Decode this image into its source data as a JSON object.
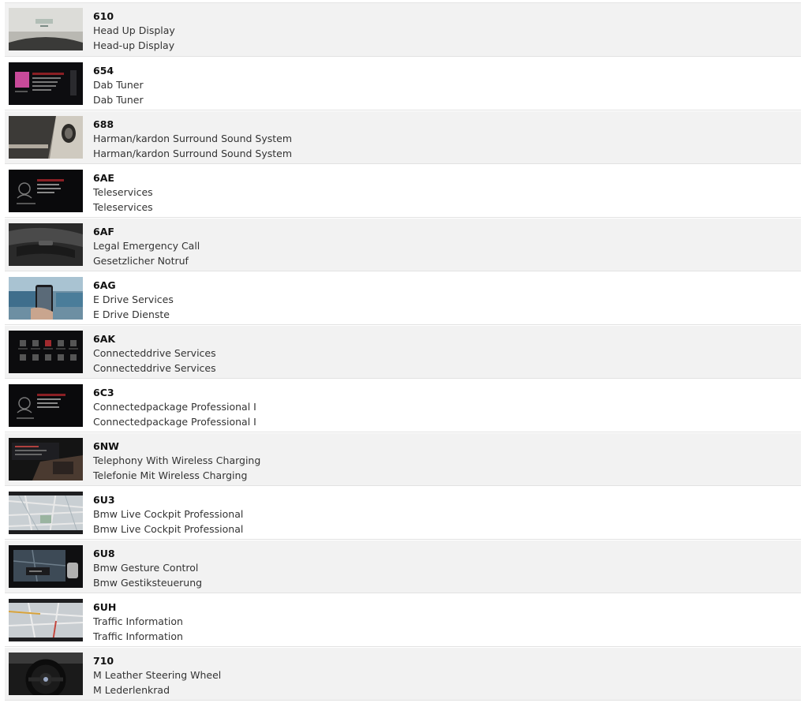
{
  "options": [
    {
      "code": "610",
      "name_en": "Head Up Display",
      "name_de": "Head-up Display",
      "thumb": "hud-image"
    },
    {
      "code": "654",
      "name_en": "Dab Tuner",
      "name_de": "Dab Tuner",
      "thumb": "radio-screen-image"
    },
    {
      "code": "688",
      "name_en": "Harman/kardon Surround Sound System",
      "name_de": "Harman/kardon Surround Sound System",
      "thumb": "door-speaker-image"
    },
    {
      "code": "6AE",
      "name_en": "Teleservices",
      "name_de": "Teleservices",
      "thumb": "teleservices-screen-image"
    },
    {
      "code": "6AF",
      "name_en": "Legal Emergency Call",
      "name_de": "Gesetzlicher Notruf",
      "thumb": "sos-button-image"
    },
    {
      "code": "6AG",
      "name_en": "E Drive Services",
      "name_de": "E Drive Dienste",
      "thumb": "phone-app-image"
    },
    {
      "code": "6AK",
      "name_en": "Connecteddrive Services",
      "name_de": "Connecteddrive Services",
      "thumb": "connecteddrive-menu-image"
    },
    {
      "code": "6C3",
      "name_en": "Connectedpackage Professional I",
      "name_de": "Connectedpackage Professional I",
      "thumb": "connected-package-screen-image"
    },
    {
      "code": "6NW",
      "name_en": "Telephony With Wireless Charging",
      "name_de": "Telefonie Mit Wireless Charging",
      "thumb": "wireless-charging-image"
    },
    {
      "code": "6U3",
      "name_en": "Bmw Live Cockpit Professional",
      "name_de": "Bmw Live Cockpit Professional",
      "thumb": "navigation-map-image"
    },
    {
      "code": "6U8",
      "name_en": "Bmw Gesture Control",
      "name_de": "Bmw Gestiksteuerung",
      "thumb": "gesture-control-image"
    },
    {
      "code": "6UH",
      "name_en": "Traffic Information",
      "name_de": "Traffic Information",
      "thumb": "traffic-map-image"
    },
    {
      "code": "710",
      "name_en": "M Leather Steering Wheel",
      "name_de": "M Lederlenkrad",
      "thumb": "steering-wheel-image"
    }
  ]
}
